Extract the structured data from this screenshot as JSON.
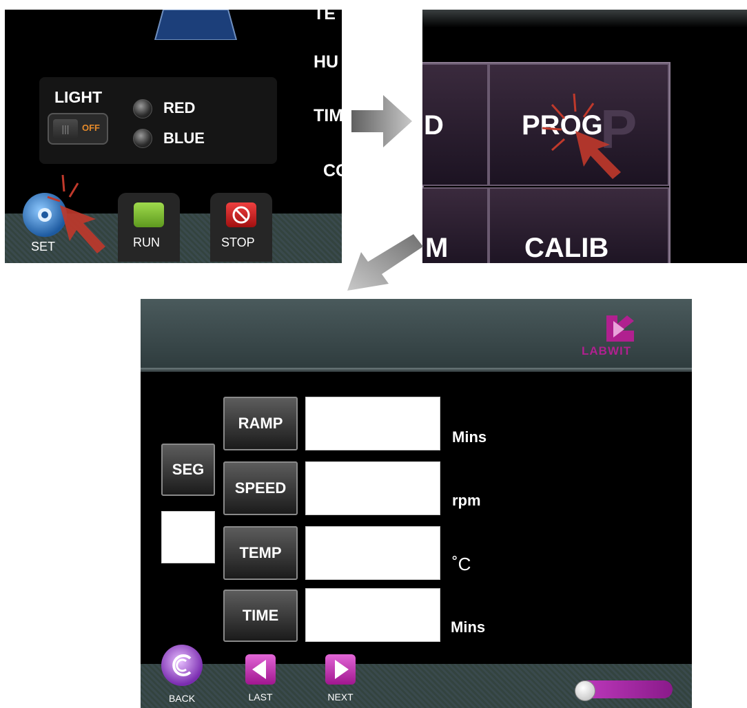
{
  "panel1": {
    "partial_labels": [
      "TE",
      "HU",
      "TIM",
      "CO"
    ],
    "light": {
      "title": "LIGHT",
      "switch_state": "OFF",
      "options": [
        "RED",
        "BLUE"
      ]
    },
    "buttons": {
      "set": "SET",
      "run": "RUN",
      "stop": "STOP"
    }
  },
  "panel2": {
    "tiles": [
      "D",
      "PROG",
      "M",
      "CALIB"
    ]
  },
  "panel3": {
    "logo": "LABWIT",
    "seg_label": "SEG",
    "rows": [
      {
        "label": "RAMP",
        "unit": "Mins"
      },
      {
        "label": "SPEED",
        "unit": "rpm"
      },
      {
        "label": "TEMP",
        "unit": "˚C"
      },
      {
        "label": "TIME",
        "unit": "Mins"
      }
    ],
    "nav": {
      "back": "BACK",
      "last": "LAST",
      "next": "NEXT"
    }
  },
  "colors": {
    "accent": "#b0208f",
    "cursor": "#c0392b",
    "arrow": "#8c8c8c"
  }
}
